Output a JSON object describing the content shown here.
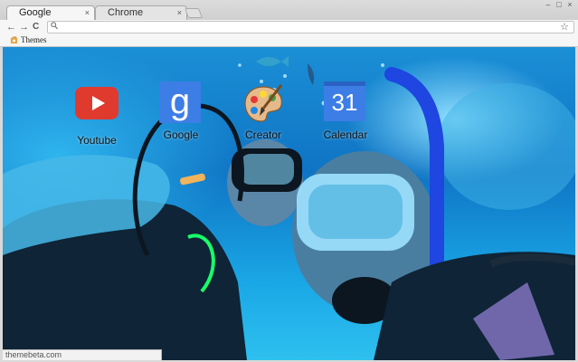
{
  "tabs": [
    {
      "label": "Google",
      "close": "×"
    },
    {
      "label": "Chrome",
      "close": "×"
    }
  ],
  "window_controls": {
    "minimize": "–",
    "maximize": "□",
    "close": "×"
  },
  "toolbar": {
    "back": "←",
    "forward": "→",
    "reload": "C",
    "search_glyph": "🔍",
    "star": "☆"
  },
  "bookmarks": [
    {
      "label": "Themes",
      "icon": "themes-folder-icon"
    }
  ],
  "apps": [
    {
      "label": "Youtube",
      "icon": "youtube-icon"
    },
    {
      "label": "Google",
      "icon": "google-search-icon",
      "glyph": "g"
    },
    {
      "label": "Creator",
      "icon": "palette-icon"
    },
    {
      "label": "Calendar",
      "icon": "calendar-icon",
      "glyph": "31"
    }
  ],
  "status": {
    "url": "themebeta.com"
  },
  "colors": {
    "youtube_red": "#e03a2f",
    "google_blue": "#3d7de6",
    "underwater_blue": "#1b8fd6"
  }
}
